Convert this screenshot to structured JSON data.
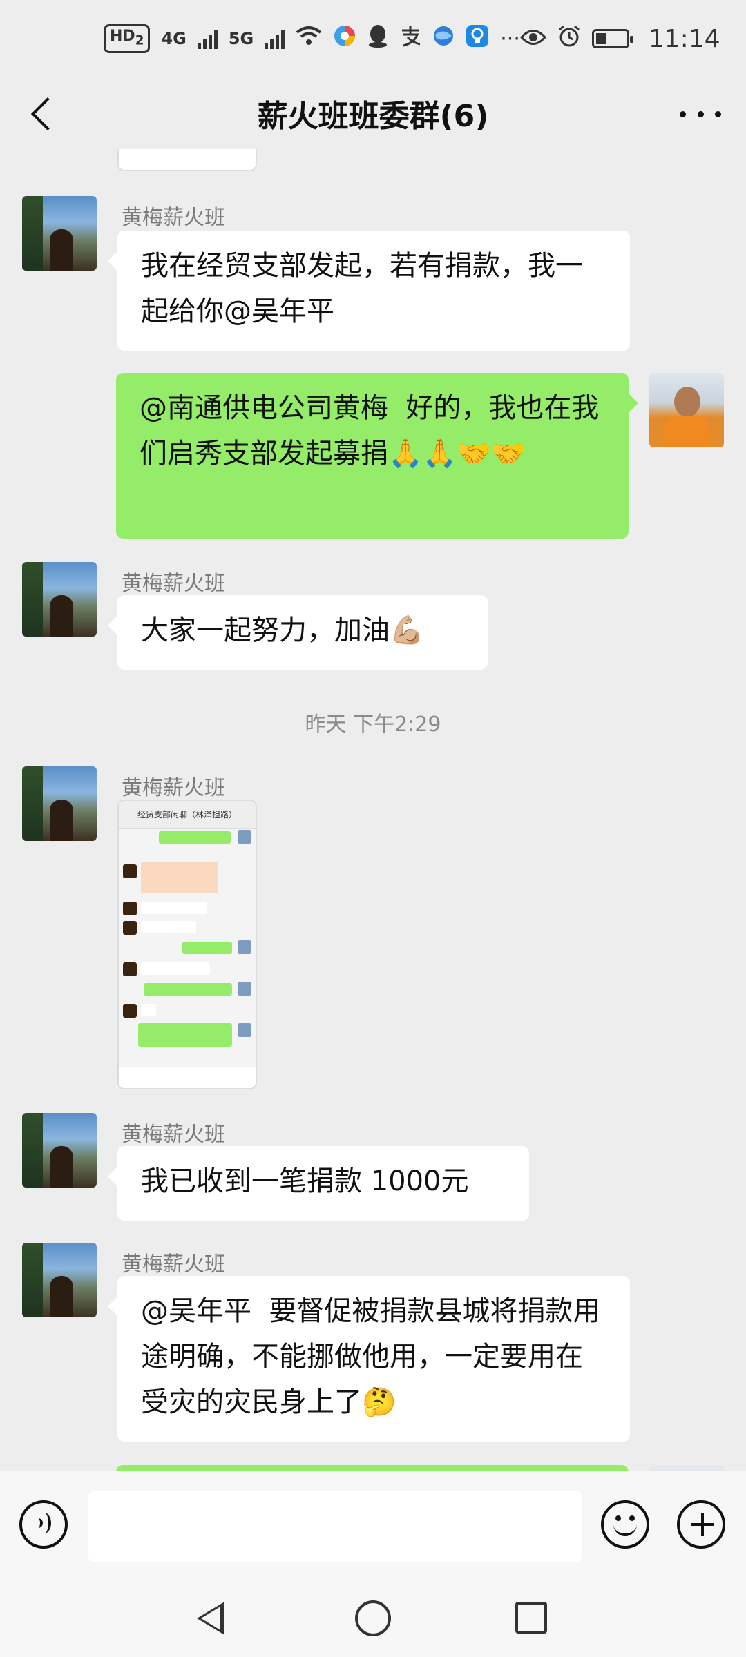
{
  "status_bar": {
    "hd": "HD",
    "hd_sub": "2",
    "net1": "4G",
    "net2": "5G",
    "time": "11:14"
  },
  "header": {
    "title": "薪火班班委群(6)"
  },
  "messages": [
    {
      "sender": "黄梅薪火班",
      "text": "我在经贸支部发起，若有捐款，我一起给你@吴年平"
    },
    {
      "text": "@南通供电公司黄梅  好的，我也在我们启秀支部发起募捐🙏🙏🤝🤝"
    },
    {
      "sender": "黄梅薪火班",
      "text": "大家一起努力，加油💪🏼"
    },
    {
      "sender": "黄梅薪火班",
      "image_title": "经贸支部闲聊（林泽担路）"
    },
    {
      "sender": "黄梅薪火班",
      "text": "我已收到一笔捐款 1000元"
    },
    {
      "sender": "黄梅薪火班",
      "text": "@吴年平  要督促被捐款县城将捐款用途明确，不能挪做他用，一定要用在受灾的灾民身上了🤔"
    }
  ],
  "timestamp": "昨天 下午2:29",
  "input": {
    "placeholder": ""
  },
  "icons": [
    "back-icon",
    "more-icon",
    "voice-icon",
    "emoji-icon",
    "plus-icon",
    "nav-back-icon",
    "nav-home-icon",
    "nav-recent-icon"
  ],
  "colors": {
    "background": "#ededed",
    "own_bubble": "#95ec69",
    "other_bubble": "#ffffff"
  }
}
